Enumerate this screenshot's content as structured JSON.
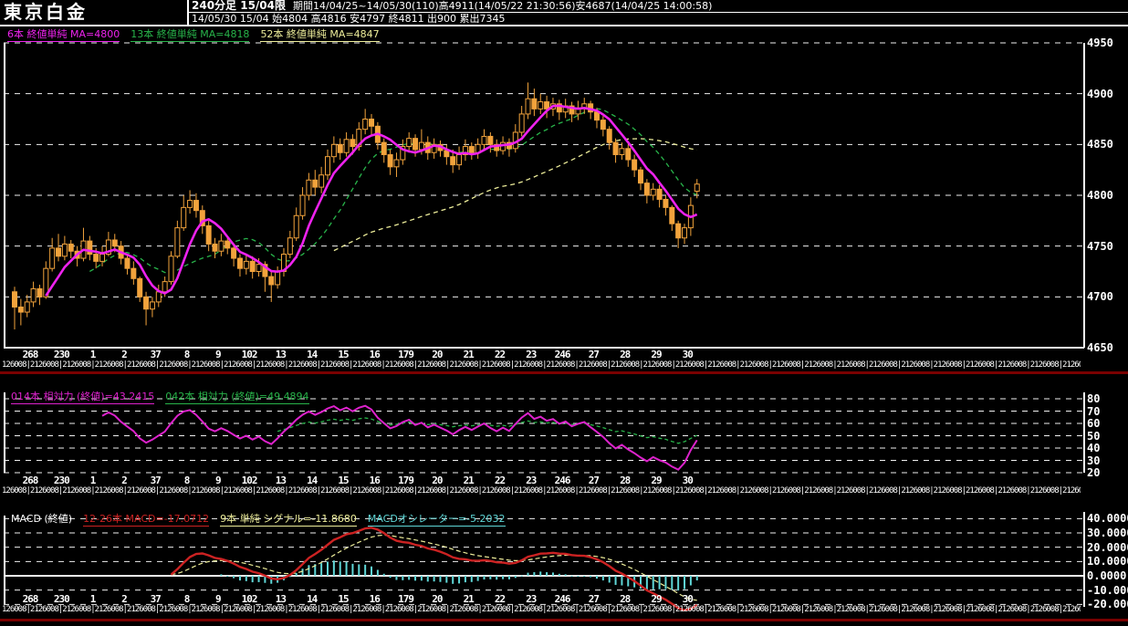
{
  "header": {
    "title": "東京白金",
    "timeframe": "240分足 15/04限",
    "period_info": "期間14/04/25~14/05/30(110)高4911(14/05/22 21:30:56)安4687(14/04/25 14:00:58)",
    "ohlc_info": "14/05/30 15/04 始4804 高4816 安4797 終4811 出900 累出7345"
  },
  "ma_legend": [
    {
      "label": "6本 終値単純 MA=4800",
      "color": "#ee22ee"
    },
    {
      "label": "13本 終値単純 MA=4818",
      "color": "#28b44a"
    },
    {
      "label": "52本 終値単純 MA=4847",
      "color": "#eded9a"
    }
  ],
  "rsi_legend": [
    {
      "label": "014本 相対力 (終値)=43.2415",
      "color": "#dd22cc"
    },
    {
      "label": "042本 相対力 (終値)=49.4894",
      "color": "#28b44a"
    }
  ],
  "macd_legend": {
    "title": "MACD (終値)",
    "items": [
      {
        "label": "12-26本 MACD=-17.0712",
        "color": "#cc2222"
      },
      {
        "label": "9本 単純 シグナル=-11.8680",
        "color": "#eded9a"
      },
      {
        "label": "MACDオシレーター=-5.2032",
        "color": "#5fd7d7"
      }
    ]
  },
  "axes": {
    "main": [
      {
        "label": "4950",
        "value": 4950,
        "solid": false
      },
      {
        "label": "4900",
        "value": 4900,
        "solid": false
      },
      {
        "label": "4850",
        "value": 4850,
        "solid": false
      },
      {
        "label": "4800",
        "value": 4800,
        "solid": false
      },
      {
        "label": "4750",
        "value": 4750,
        "solid": false
      },
      {
        "label": "4700",
        "value": 4700,
        "solid": false
      },
      {
        "label": "4650",
        "value": 4650,
        "solid": true
      }
    ],
    "rsi": [
      {
        "label": "80",
        "value": 80,
        "solid": false
      },
      {
        "label": "70",
        "value": 70,
        "solid": false
      },
      {
        "label": "60",
        "value": 60,
        "solid": false
      },
      {
        "label": "50",
        "value": 50,
        "solid": false
      },
      {
        "label": "40",
        "value": 40,
        "solid": false
      },
      {
        "label": "30",
        "value": 30,
        "solid": false
      },
      {
        "label": "20",
        "value": 20,
        "solid": false
      }
    ],
    "macd": [
      {
        "label": "40.0000",
        "value": 40,
        "solid": false
      },
      {
        "label": "30.0000",
        "value": 30,
        "solid": false
      },
      {
        "label": "20.0000",
        "value": 20,
        "solid": false
      },
      {
        "label": "10.0000",
        "value": 10,
        "solid": false
      },
      {
        "label": "0.0000",
        "value": 0,
        "solid": true
      },
      {
        "label": "-10.0000",
        "value": -10,
        "solid": false
      },
      {
        "label": "-20.0000",
        "value": -20,
        "solid": false
      }
    ]
  },
  "x_axis": {
    "day_labels": [
      "268",
      "230",
      "1",
      "2",
      "37",
      "8",
      "9",
      "102",
      "13",
      "14",
      "15",
      "16",
      "179",
      "20",
      "21",
      "22",
      "23",
      "246",
      "27",
      "28",
      "29",
      "30"
    ],
    "time_row_pattern": "126008|2"
  },
  "chart_data": {
    "type": "candlestick",
    "title": "東京白金 240分足 15/04限",
    "bars_shown": 110,
    "ylim_main": [
      4650,
      4950
    ],
    "ylim_rsi": [
      20,
      80
    ],
    "ylim_macd": [
      -20,
      40
    ],
    "overlays": [
      {
        "name": "MA6",
        "period": 6,
        "style": "solid"
      },
      {
        "name": "MA13",
        "period": 13,
        "style": "dashed"
      },
      {
        "name": "MA52",
        "period": 52,
        "style": "dashed"
      }
    ],
    "rsi_periods": [
      14,
      42
    ],
    "macd_params": {
      "fast": 12,
      "slow": 26,
      "signal": 9
    },
    "colors": {
      "candle": "#f2a33c",
      "up_fill": "#000000",
      "ma6": "#ee22ee",
      "ma13": "#28b44a",
      "ma52": "#eded9a",
      "rsi14": "#dd22cc",
      "rsi42": "#28b44a",
      "macd": "#cc2222",
      "signal": "#eded9a",
      "hist": "#5fd7d7",
      "grid": "#f0f0f0",
      "separator": "#7a0101"
    },
    "candles": [
      [
        4705,
        4710,
        4668,
        4690
      ],
      [
        4690,
        4698,
        4672,
        4685
      ],
      [
        4685,
        4702,
        4680,
        4695
      ],
      [
        4695,
        4715,
        4690,
        4708
      ],
      [
        4708,
        4712,
        4692,
        4700
      ],
      [
        4700,
        4735,
        4698,
        4728
      ],
      [
        4728,
        4758,
        4725,
        4748
      ],
      [
        4748,
        4762,
        4735,
        4740
      ],
      [
        4740,
        4760,
        4736,
        4752
      ],
      [
        4752,
        4756,
        4738,
        4745
      ],
      [
        4745,
        4750,
        4730,
        4738
      ],
      [
        4738,
        4768,
        4735,
        4755
      ],
      [
        4755,
        4760,
        4736,
        4742
      ],
      [
        4742,
        4748,
        4728,
        4735
      ],
      [
        4735,
        4750,
        4730,
        4742
      ],
      [
        4742,
        4764,
        4740,
        4756
      ],
      [
        4756,
        4762,
        4744,
        4750
      ],
      [
        4750,
        4755,
        4732,
        4738
      ],
      [
        4738,
        4742,
        4722,
        4728
      ],
      [
        4728,
        4735,
        4712,
        4718
      ],
      [
        4718,
        4720,
        4695,
        4700
      ],
      [
        4700,
        4705,
        4672,
        4688
      ],
      [
        4688,
        4700,
        4680,
        4695
      ],
      [
        4695,
        4712,
        4690,
        4705
      ],
      [
        4705,
        4720,
        4700,
        4715
      ],
      [
        4715,
        4745,
        4712,
        4740
      ],
      [
        4740,
        4775,
        4738,
        4768
      ],
      [
        4768,
        4800,
        4765,
        4788
      ],
      [
        4788,
        4805,
        4782,
        4795
      ],
      [
        4795,
        4802,
        4778,
        4785
      ],
      [
        4785,
        4790,
        4762,
        4770
      ],
      [
        4770,
        4775,
        4745,
        4752
      ],
      [
        4752,
        4758,
        4738,
        4745
      ],
      [
        4745,
        4762,
        4740,
        4755
      ],
      [
        4755,
        4760,
        4742,
        4748
      ],
      [
        4748,
        4752,
        4730,
        4738
      ],
      [
        4738,
        4742,
        4720,
        4728
      ],
      [
        4728,
        4742,
        4722,
        4735
      ],
      [
        4735,
        4740,
        4718,
        4725
      ],
      [
        4725,
        4738,
        4720,
        4732
      ],
      [
        4732,
        4735,
        4705,
        4720
      ],
      [
        4720,
        4725,
        4695,
        4712
      ],
      [
        4712,
        4730,
        4708,
        4725
      ],
      [
        4725,
        4748,
        4720,
        4742
      ],
      [
        4742,
        4765,
        4738,
        4758
      ],
      [
        4758,
        4788,
        4755,
        4780
      ],
      [
        4780,
        4808,
        4776,
        4800
      ],
      [
        4800,
        4822,
        4795,
        4815
      ],
      [
        4815,
        4825,
        4800,
        4808
      ],
      [
        4808,
        4828,
        4802,
        4820
      ],
      [
        4820,
        4845,
        4815,
        4838
      ],
      [
        4838,
        4858,
        4832,
        4850
      ],
      [
        4850,
        4856,
        4835,
        4842
      ],
      [
        4842,
        4862,
        4838,
        4855
      ],
      [
        4855,
        4860,
        4840,
        4848
      ],
      [
        4848,
        4872,
        4844,
        4865
      ],
      [
        4865,
        4885,
        4860,
        4875
      ],
      [
        4875,
        4880,
        4858,
        4868
      ],
      [
        4868,
        4872,
        4845,
        4852
      ],
      [
        4852,
        4856,
        4832,
        4840
      ],
      [
        4840,
        4845,
        4820,
        4828
      ],
      [
        4828,
        4842,
        4818,
        4835
      ],
      [
        4835,
        4855,
        4830,
        4848
      ],
      [
        4848,
        4862,
        4842,
        4856
      ],
      [
        4856,
        4860,
        4838,
        4845
      ],
      [
        4845,
        4865,
        4840,
        4852
      ],
      [
        4852,
        4858,
        4835,
        4842
      ],
      [
        4842,
        4856,
        4836,
        4850
      ],
      [
        4850,
        4854,
        4838,
        4844
      ],
      [
        4844,
        4850,
        4830,
        4838
      ],
      [
        4838,
        4845,
        4822,
        4830
      ],
      [
        4830,
        4848,
        4825,
        4840
      ],
      [
        4840,
        4855,
        4834,
        4848
      ],
      [
        4848,
        4852,
        4835,
        4842
      ],
      [
        4842,
        4856,
        4836,
        4850
      ],
      [
        4850,
        4865,
        4845,
        4858
      ],
      [
        4858,
        4862,
        4842,
        4850
      ],
      [
        4850,
        4855,
        4838,
        4844
      ],
      [
        4844,
        4858,
        4840,
        4852
      ],
      [
        4852,
        4856,
        4838,
        4846
      ],
      [
        4846,
        4870,
        4842,
        4862
      ],
      [
        4862,
        4888,
        4858,
        4880
      ],
      [
        4880,
        4911,
        4875,
        4895
      ],
      [
        4895,
        4905,
        4878,
        4885
      ],
      [
        4885,
        4900,
        4880,
        4892
      ],
      [
        4892,
        4898,
        4876,
        4885
      ],
      [
        4885,
        4896,
        4878,
        4890
      ],
      [
        4890,
        4894,
        4874,
        4882
      ],
      [
        4882,
        4895,
        4876,
        4888
      ],
      [
        4888,
        4892,
        4872,
        4880
      ],
      [
        4880,
        4893,
        4874,
        4886
      ],
      [
        4886,
        4896,
        4880,
        4890
      ],
      [
        4890,
        4893,
        4875,
        4882
      ],
      [
        4882,
        4886,
        4866,
        4874
      ],
      [
        4874,
        4878,
        4858,
        4865
      ],
      [
        4865,
        4868,
        4845,
        4852
      ],
      [
        4852,
        4856,
        4832,
        4840
      ],
      [
        4840,
        4852,
        4835,
        4846
      ],
      [
        4846,
        4850,
        4828,
        4835
      ],
      [
        4835,
        4840,
        4818,
        4825
      ],
      [
        4825,
        4828,
        4805,
        4812
      ],
      [
        4812,
        4816,
        4792,
        4800
      ],
      [
        4800,
        4812,
        4795,
        4806
      ],
      [
        4806,
        4810,
        4788,
        4796
      ],
      [
        4796,
        4800,
        4780,
        4788
      ],
      [
        4788,
        4790,
        4765,
        4772
      ],
      [
        4772,
        4775,
        4748,
        4758
      ],
      [
        4758,
        4772,
        4752,
        4768
      ],
      [
        4768,
        4798,
        4760,
        4790
      ],
      [
        4804,
        4816,
        4797,
        4811
      ]
    ]
  }
}
